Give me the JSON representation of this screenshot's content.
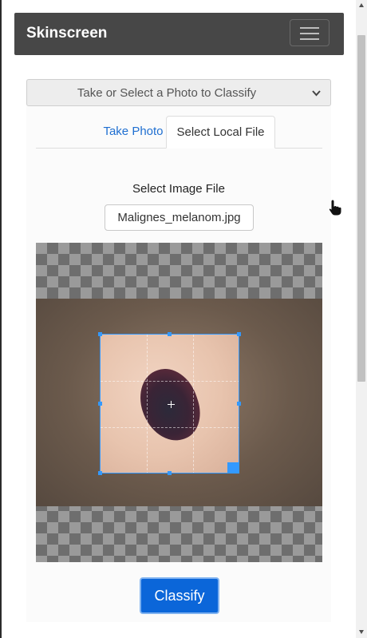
{
  "navbar": {
    "brand": "Skinscreen"
  },
  "select_header": {
    "label": "Take or Select a Photo to Classify"
  },
  "tabs": [
    {
      "label": "Take Photo",
      "active": false
    },
    {
      "label": "Select Local File",
      "active": true
    }
  ],
  "file_picker": {
    "label": "Select Image File",
    "file_name": "Malignes_melanom.jpg"
  },
  "actions": {
    "classify_label": "Classify"
  },
  "colors": {
    "navbar_bg": "#474747",
    "accent": "#0b66d9",
    "crop_border": "#3399ff",
    "tab_link": "#1f6fd1"
  },
  "icons": {
    "menu": "hamburger-icon",
    "dropdown": "chevron-down-icon",
    "cursor": "hand-pointer-icon"
  }
}
